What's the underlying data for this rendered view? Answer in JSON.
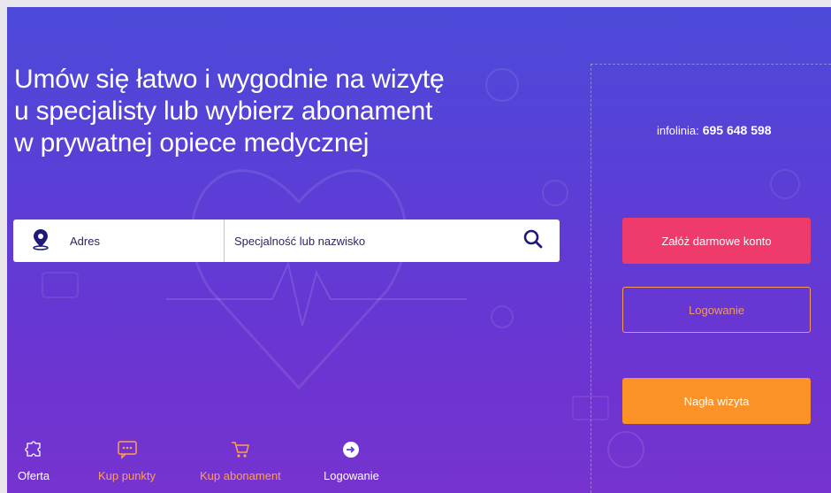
{
  "headline": {
    "line1": "Umów się łatwo i wygodnie na wizytę",
    "line2": "u specjalisty lub wybierz abonament",
    "line3": "w prywatnej opiece medycznej"
  },
  "hotline": {
    "label": "infolinia:",
    "number": "695 648 598"
  },
  "search": {
    "address_placeholder": "Adres",
    "specialty_placeholder": "Specjalność lub nazwisko",
    "icons": {
      "address": "map-pin-icon",
      "submit": "search-icon"
    }
  },
  "actions": {
    "register": "Załóż darmowe konto",
    "login": "Logowanie",
    "urgent": "Nagła wizyta"
  },
  "bottom_nav": [
    {
      "label": "Oferta",
      "icon": "puzzle-icon"
    },
    {
      "label": "Kup punkty",
      "icon": "chat-dots-icon"
    },
    {
      "label": "Kup abonament",
      "icon": "cart-icon"
    },
    {
      "label": "Logowanie",
      "icon": "login-arrow-icon"
    }
  ],
  "colors": {
    "background_top": "#4c4ad8",
    "background_bottom": "#7633cf",
    "register": "#ee3b6b",
    "login_outline": "#f39a56",
    "urgent": "#fb9227",
    "accent_text": "#ffa04a",
    "search_text": "#2d2560"
  }
}
